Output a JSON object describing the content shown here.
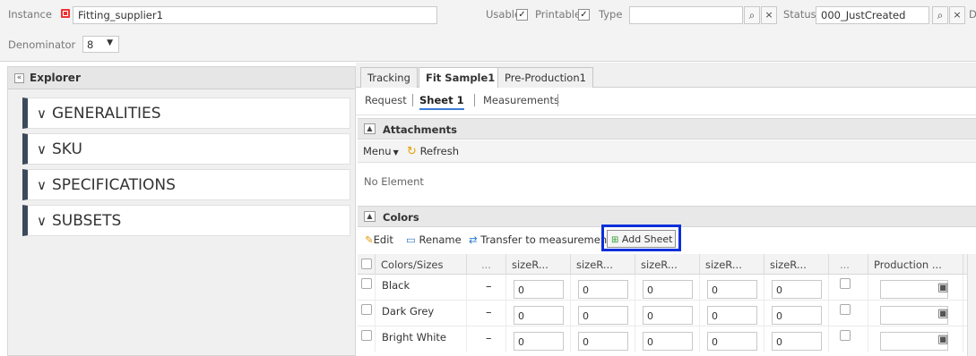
{
  "header": {
    "instance_label": "Instance",
    "instance_value": "Fitting_supplier1",
    "usable_label": "Usable",
    "printable_label": "Printable",
    "type_label": "Type",
    "type_value": "",
    "status_label": "Status",
    "status_value": "000_JustCreated",
    "denominator_label": "Denominator",
    "denominator_value": "8",
    "trailing_label": "D"
  },
  "explorer": {
    "title": "Explorer",
    "sections": [
      "GENERALITIES",
      "SKU",
      "SPECIFICATIONS",
      "SUBSETS"
    ]
  },
  "tabs": [
    "Tracking",
    "Fit Sample1",
    "Pre-Production1"
  ],
  "subtabs": [
    "Request",
    "Sheet 1",
    "Measurements"
  ],
  "attachments": {
    "title": "Attachments",
    "menu_label": "Menu",
    "refresh_label": "Refresh",
    "empty_text": "No Element"
  },
  "colors": {
    "title": "Colors",
    "edit_label": "Edit",
    "rename_label": "Rename",
    "transfer_label": "Transfer to measurement",
    "add_sheet_label": "Add Sheet",
    "columns": [
      "Colors/Sizes",
      "...",
      "sizeR...",
      "sizeR...",
      "sizeR...",
      "sizeR...",
      "sizeR...",
      "...",
      "Production ..."
    ],
    "rows": [
      {
        "name": "Black",
        "dash": "–",
        "values": [
          "0",
          "0",
          "0",
          "0",
          "0"
        ]
      },
      {
        "name": "Dark Grey",
        "dash": "–",
        "values": [
          "0",
          "0",
          "0",
          "0",
          "0"
        ]
      },
      {
        "name": "Bright White",
        "dash": "–",
        "values": [
          "0",
          "0",
          "0",
          "0",
          "0"
        ]
      }
    ]
  },
  "theme": {
    "highlight": "#0a2fd9",
    "accordion_bar": "#3b4a5c",
    "tab_underline": "#3a7bd5"
  }
}
